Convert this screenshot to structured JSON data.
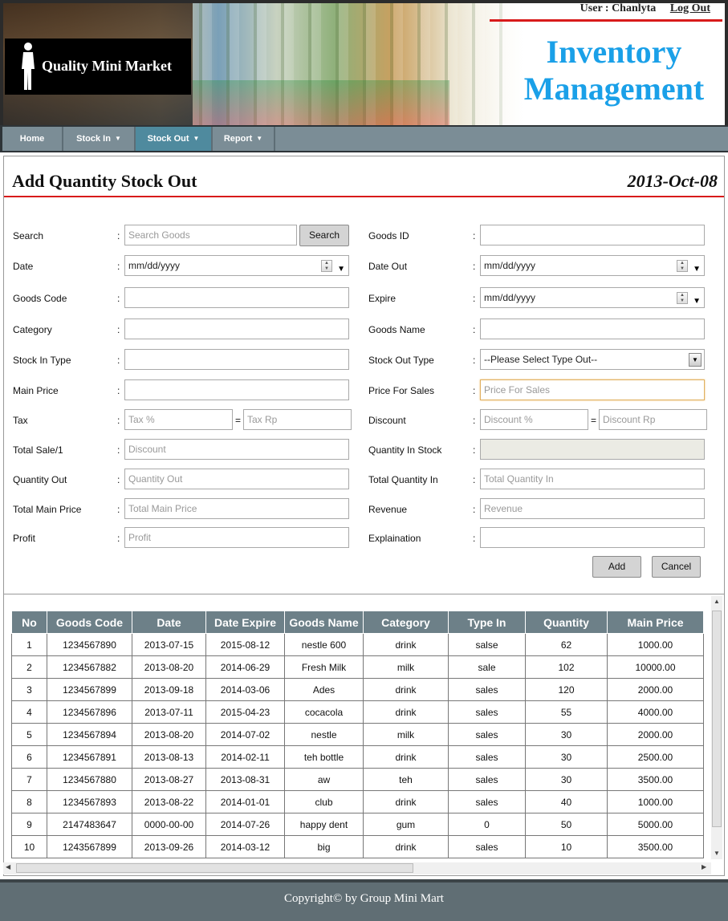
{
  "header": {
    "brand": "Quality Mini Market",
    "user_label": "User : Chanlyta",
    "logout_label": "Log Out",
    "title_line1": "Inventory",
    "title_line2": "Management"
  },
  "nav": {
    "items": [
      {
        "label": "Home"
      },
      {
        "label": "Stock In"
      },
      {
        "label": "Stock Out"
      },
      {
        "label": "Report"
      }
    ]
  },
  "page": {
    "title": "Add Quantity Stock Out",
    "date": "2013-Oct-08"
  },
  "form": {
    "left": {
      "search_label": "Search",
      "search_placeholder": "Search Goods",
      "search_button": "Search",
      "date_label": "Date",
      "date_value": "mm/dd/yyyy",
      "goods_code_label": "Goods Code",
      "category_label": "Category",
      "stock_in_type_label": "Stock In Type",
      "main_price_label": "Main Price",
      "tax_label": "Tax",
      "tax_pct_placeholder": "Tax %",
      "tax_rp_placeholder": "Tax Rp",
      "total_sale_label": "Total Sale/1",
      "total_sale_placeholder": "Discount",
      "quantity_out_label": "Quantity Out",
      "quantity_out_placeholder": "Quantity Out",
      "total_main_price_label": "Total Main Price",
      "total_main_price_placeholder": "Total Main Price",
      "profit_label": "Profit",
      "profit_placeholder": "Profit"
    },
    "right": {
      "goods_id_label": "Goods ID",
      "date_out_label": "Date Out",
      "date_out_value": "mm/dd/yyyy",
      "expire_label": "Expire",
      "expire_value": "mm/dd/yyyy",
      "goods_name_label": "Goods Name",
      "stock_out_type_label": "Stock Out Type",
      "stock_out_type_value": "--Please Select Type Out--",
      "price_for_sales_label": "Price For Sales",
      "price_for_sales_placeholder": "Price For Sales",
      "discount_label": "Discount",
      "discount_pct_placeholder": "Discount %",
      "discount_rp_placeholder": "Discount Rp",
      "quantity_in_stock_label": "Quantity In Stock",
      "total_quantity_in_label": "Total Quantity In",
      "total_quantity_in_placeholder": "Total Quantity In",
      "revenue_label": "Revenue",
      "revenue_placeholder": "Revenue",
      "explaination_label": "Explaination"
    },
    "colon": ":",
    "equals": "=",
    "add_button": "Add",
    "cancel_button": "Cancel"
  },
  "table": {
    "headers": [
      "No",
      "Goods Code",
      "Date",
      "Date Expire",
      "Goods Name",
      "Category",
      "Type In",
      "Quantity",
      "Main Price"
    ],
    "rows": [
      [
        "1",
        "1234567890",
        "2013-07-15",
        "2015-08-12",
        "nestle 600",
        "drink",
        "salse",
        "62",
        "1000.00"
      ],
      [
        "2",
        "1234567882",
        "2013-08-20",
        "2014-06-29",
        "Fresh Milk",
        "milk",
        "sale",
        "102",
        "10000.00"
      ],
      [
        "3",
        "1234567899",
        "2013-09-18",
        "2014-03-06",
        "Ades",
        "drink",
        "sales",
        "120",
        "2000.00"
      ],
      [
        "4",
        "1234567896",
        "2013-07-11",
        "2015-04-23",
        "cocacola",
        "drink",
        "sales",
        "55",
        "4000.00"
      ],
      [
        "5",
        "1234567894",
        "2013-08-20",
        "2014-07-02",
        "nestle",
        "milk",
        "sales",
        "30",
        "2000.00"
      ],
      [
        "6",
        "1234567891",
        "2013-08-13",
        "2014-02-11",
        "teh bottle",
        "drink",
        "sales",
        "30",
        "2500.00"
      ],
      [
        "7",
        "1234567880",
        "2013-08-27",
        "2013-08-31",
        "aw",
        "teh",
        "sales",
        "30",
        "3500.00"
      ],
      [
        "8",
        "1234567893",
        "2013-08-22",
        "2014-01-01",
        "club",
        "drink",
        "sales",
        "40",
        "1000.00"
      ],
      [
        "9",
        "2147483647",
        "0000-00-00",
        "2014-07-26",
        "happy dent",
        "gum",
        "0",
        "50",
        "5000.00"
      ],
      [
        "10",
        "1243567899",
        "2013-09-26",
        "2014-03-12",
        "big",
        "drink",
        "sales",
        "10",
        "3500.00"
      ]
    ]
  },
  "footer": {
    "text": "Copyright© by Group Mini Mart"
  },
  "colors": {
    "accent_blue": "#1aa0e8",
    "nav_bg": "#7b8d96",
    "nav_active": "#4f8a9e",
    "table_header": "#6d8088",
    "red_rule": "#d81a1a",
    "footer_bg": "#606e74"
  }
}
